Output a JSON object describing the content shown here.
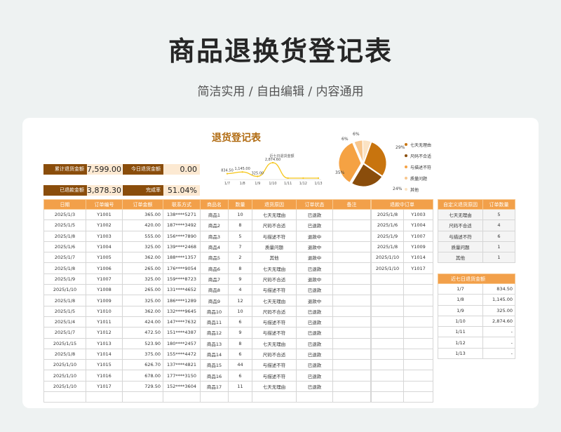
{
  "hero": {
    "title": "商品退换货登记表",
    "subtitle": "简洁实用 / 自由编辑 / 内容通用"
  },
  "sheet": {
    "title": "退货登记表",
    "kpis": [
      {
        "label": "累计退货金额",
        "value": "7,599.00"
      },
      {
        "label": "今日退货金额",
        "value": "0.00"
      },
      {
        "label": "已退款金额",
        "value": "3,878.30"
      },
      {
        "label": "完成率",
        "value": "51.04%"
      }
    ]
  },
  "chart_data": [
    {
      "type": "line",
      "title": "近七日退货金额",
      "x": [
        "1/7",
        "1/8",
        "1/9",
        "1/10",
        "1/11",
        "1/12",
        "1/13"
      ],
      "value_labels": [
        "834.50",
        "1,145.00",
        "325.00",
        "2,874.60",
        "-",
        "-",
        "-"
      ],
      "values": [
        834.5,
        1145.0,
        325.0,
        2874.6,
        0,
        0,
        0
      ],
      "color": "#f5c518"
    },
    {
      "type": "pie",
      "labels": [
        "七天无理由",
        "尺码不合适",
        "与描述不符",
        "质量问题",
        "其他"
      ],
      "values": [
        29,
        24,
        35,
        6,
        6
      ],
      "value_labels": [
        "29%",
        "24%",
        "35%",
        "6%",
        "6%"
      ],
      "colors": [
        "#c8740e",
        "#8a4d0b",
        "#f5a243",
        "#f8c68d",
        "#fbe3c4"
      ]
    }
  ],
  "main_table": {
    "headers": [
      "日期",
      "订单编号",
      "订单金额",
      "联系方式",
      "商品名",
      "数量",
      "退货原因",
      "订单状态",
      "备注"
    ],
    "rows": [
      [
        "2025/1/3",
        "Y1001",
        "365.00",
        "138****5271",
        "商品1",
        "10",
        "七天无理由",
        "已退款",
        ""
      ],
      [
        "2025/1/5",
        "Y1002",
        "420.00",
        "187****3492",
        "商品2",
        "8",
        "尺码不合适",
        "已退款",
        ""
      ],
      [
        "2025/1/8",
        "Y1003",
        "555.00",
        "156****7890",
        "商品3",
        "5",
        "与描述不符",
        "退款中",
        ""
      ],
      [
        "2025/1/6",
        "Y1004",
        "325.00",
        "139****2468",
        "商品4",
        "7",
        "质量问题",
        "退款中",
        ""
      ],
      [
        "2025/1/7",
        "Y1005",
        "362.00",
        "188****1357",
        "商品5",
        "2",
        "其他",
        "退款中",
        ""
      ],
      [
        "2025/1/8",
        "Y1006",
        "265.00",
        "176****9054",
        "商品6",
        "8",
        "七天无理由",
        "已退款",
        ""
      ],
      [
        "2025/1/9",
        "Y1007",
        "325.00",
        "159****8723",
        "商品7",
        "9",
        "尺码不合适",
        "退款中",
        ""
      ],
      [
        "2025/1/10",
        "Y1008",
        "265.00",
        "131****4652",
        "商品8",
        "4",
        "与描述不符",
        "已退款",
        ""
      ],
      [
        "2025/1/8",
        "Y1009",
        "325.00",
        "186****1289",
        "商品9",
        "12",
        "七天无理由",
        "退款中",
        ""
      ],
      [
        "2025/1/5",
        "Y1010",
        "362.00",
        "132****9645",
        "商品10",
        "10",
        "尺码不合适",
        "已退款",
        ""
      ],
      [
        "2025/1/4",
        "Y1011",
        "424.00",
        "147****7632",
        "商品11",
        "6",
        "与描述不符",
        "已退款",
        ""
      ],
      [
        "2025/1/7",
        "Y1012",
        "472.50",
        "151****4387",
        "商品12",
        "9",
        "与描述不符",
        "已退款",
        ""
      ],
      [
        "2025/1/15",
        "Y1013",
        "523.90",
        "180****2457",
        "商品13",
        "8",
        "七天无理由",
        "已退款",
        ""
      ],
      [
        "2025/1/8",
        "Y1014",
        "375.00",
        "155****4472",
        "商品14",
        "6",
        "尺码不合适",
        "已退款",
        ""
      ],
      [
        "2025/1/10",
        "Y1015",
        "626.70",
        "137****4821",
        "商品15",
        "44",
        "与描述不符",
        "已退款",
        ""
      ],
      [
        "2025/1/10",
        "Y1016",
        "678.00",
        "177****3150",
        "商品16",
        "6",
        "与描述不符",
        "已退款",
        ""
      ],
      [
        "2025/1/10",
        "Y1017",
        "729.50",
        "152****3604",
        "商品17",
        "11",
        "七天无理由",
        "已退款",
        ""
      ],
      [
        "",
        "",
        "",
        "",
        "",
        "",
        "",
        "",
        ""
      ]
    ]
  },
  "refund_table": {
    "header": "退款中订单",
    "rows": [
      [
        "2025/1/8",
        "Y1003"
      ],
      [
        "2025/1/6",
        "Y1004"
      ],
      [
        "2025/1/9",
        "Y1007"
      ],
      [
        "2025/1/8",
        "Y1009"
      ],
      [
        "2025/1/10",
        "Y1014"
      ],
      [
        "2025/1/10",
        "Y1017"
      ]
    ],
    "empty_rows": 12
  },
  "reason_table": {
    "headers": [
      "自定义退货原因",
      "订单数量"
    ],
    "rows": [
      [
        "七天无理由",
        "5"
      ],
      [
        "尺码不合适",
        "4"
      ],
      [
        "与描述不符",
        "6"
      ],
      [
        "质量问题",
        "1"
      ],
      [
        "其他",
        "1"
      ]
    ]
  },
  "seven_day_table": {
    "header": "近七日退货金额",
    "rows": [
      [
        "1/7",
        "834.50"
      ],
      [
        "1/8",
        "1,145.00"
      ],
      [
        "1/9",
        "325.00"
      ],
      [
        "1/10",
        "2,874.60"
      ],
      [
        "1/11",
        "-"
      ],
      [
        "1/12",
        "-"
      ],
      [
        "1/13",
        "-"
      ]
    ]
  }
}
